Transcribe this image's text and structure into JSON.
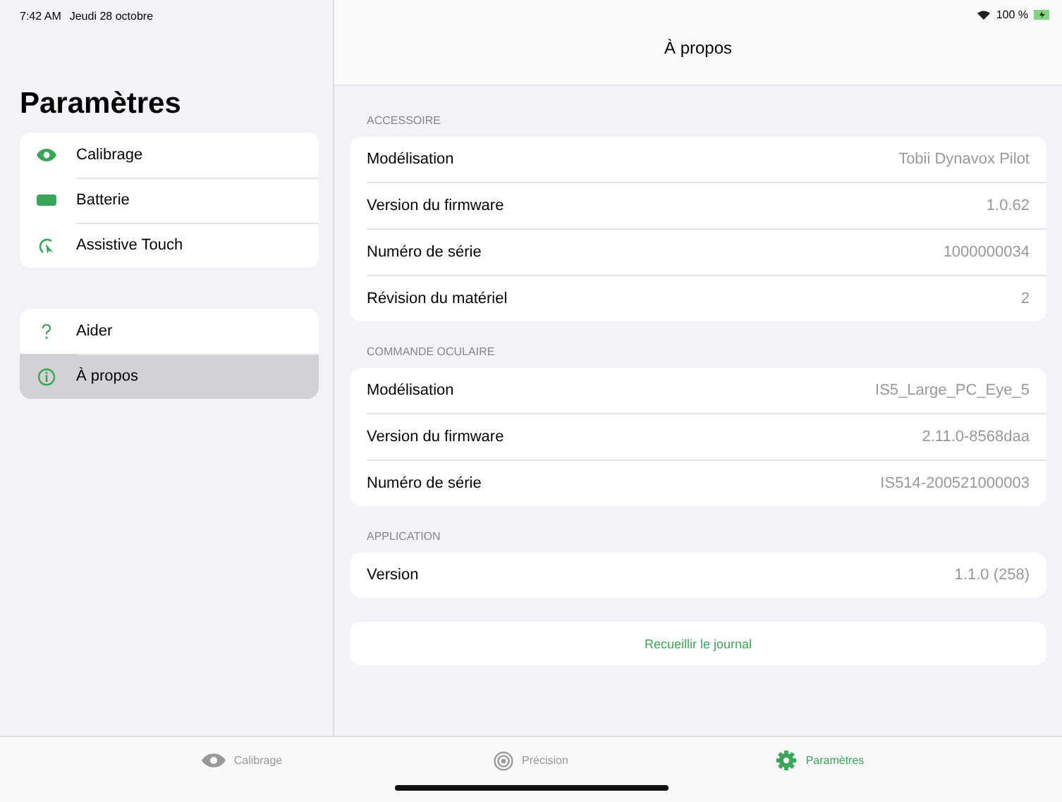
{
  "status_bar": {
    "time": "7:42 AM",
    "date": "Jeudi 28 octobre",
    "battery": "100 %"
  },
  "sidebar": {
    "title": "Paramètres",
    "groups": [
      {
        "items": [
          {
            "label": "Calibrage",
            "selected": false
          },
          {
            "label": "Batterie",
            "selected": false
          },
          {
            "label": "Assistive Touch",
            "selected": false
          }
        ]
      },
      {
        "items": [
          {
            "label": "Aider",
            "selected": false
          },
          {
            "label": "À propos",
            "selected": true
          }
        ]
      }
    ]
  },
  "detail": {
    "title": "À propos",
    "sections": [
      {
        "header": "ACCESSOIRE",
        "rows": [
          {
            "label": "Modélisation",
            "value": "Tobii Dynavox Pilot"
          },
          {
            "label": "Version du firmware",
            "value": "1.0.62"
          },
          {
            "label": "Numéro de série",
            "value": "1000000034"
          },
          {
            "label": "Révision du matériel",
            "value": "2"
          }
        ]
      },
      {
        "header": "COMMANDE OCULAIRE",
        "rows": [
          {
            "label": "Modélisation",
            "value": "IS5_Large_PC_Eye_5"
          },
          {
            "label": "Version du firmware",
            "value": "2.11.0-8568daa"
          },
          {
            "label": "Numéro de série",
            "value": "IS514-200521000003"
          }
        ]
      },
      {
        "header": "APPLICATION",
        "rows": [
          {
            "label": "Version",
            "value": "1.1.0 (258)"
          }
        ]
      }
    ],
    "action_button": "Recueillir le journal"
  },
  "tab_bar": [
    {
      "label": "Calibrage",
      "selected": false
    },
    {
      "label": "Précision",
      "selected": false
    },
    {
      "label": "Paramètres",
      "selected": true
    }
  ]
}
